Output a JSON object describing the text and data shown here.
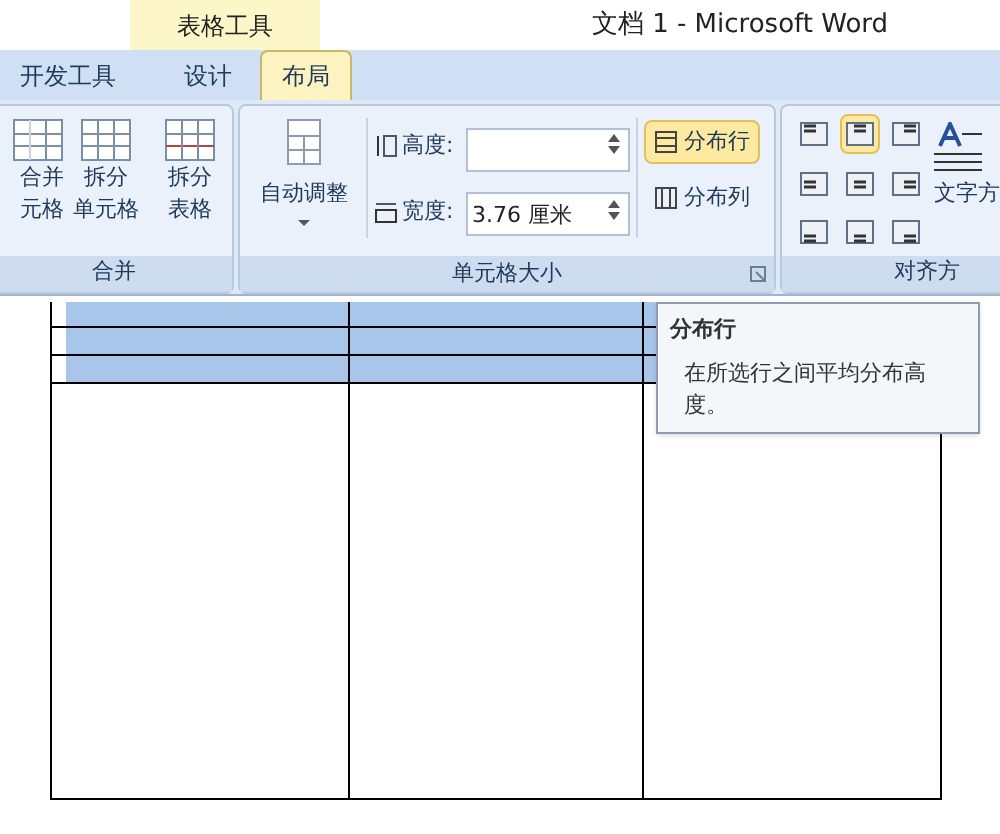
{
  "window": {
    "title": "文档 1 - Microsoft Word",
    "context_tab": "表格工具"
  },
  "tabs": [
    {
      "label": "开发工具",
      "selected": false
    },
    {
      "label": "设计",
      "selected": false
    },
    {
      "label": "布局",
      "selected": true
    }
  ],
  "merge_group": {
    "label": "合并",
    "buttons": [
      {
        "lines": [
          "合并",
          "元格"
        ]
      },
      {
        "lines": [
          "拆分",
          "单元格"
        ]
      },
      {
        "lines": [
          "拆分",
          "表格"
        ]
      }
    ]
  },
  "size_group": {
    "label": "单元格大小",
    "autofit": "自动调整",
    "fields": [
      {
        "label": "高度:"
      },
      {
        "label": "宽度:",
        "value": "3.76 厘米"
      }
    ],
    "distribute": [
      {
        "label": "分布行",
        "selected": true
      },
      {
        "label": "分布列",
        "selected": false
      }
    ]
  },
  "align_group": {
    "label": "对齐方",
    "text_direction": "文字方",
    "cells": [
      {
        "selected": false
      },
      {
        "selected": true
      },
      {
        "selected": false
      },
      {
        "selected": false
      },
      {
        "selected": false
      },
      {
        "selected": false
      },
      {
        "selected": false
      },
      {
        "selected": false
      },
      {
        "selected": false
      }
    ]
  },
  "table": {
    "rows": [
      {
        "selected": true
      },
      {
        "selected": true
      },
      {
        "selected": true
      },
      {
        "selected": false
      }
    ]
  },
  "tooltip": {
    "title": "分布行",
    "text": "在所选行之间平均分布高度。"
  }
}
